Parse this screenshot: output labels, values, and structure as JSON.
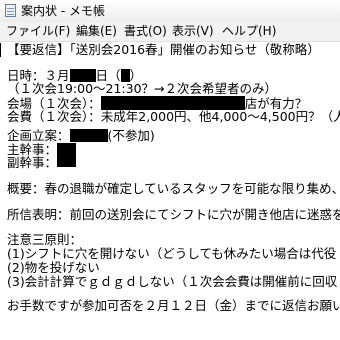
{
  "window": {
    "title": "案内状 - メモ帳"
  },
  "menu": {
    "items": [
      "ファイル(F)",
      "編集(E)",
      "書式(O)",
      "表示(V)",
      "ヘルプ(H)"
    ]
  },
  "document": {
    "line_0": "【要返信】「送別会2016春」開催のお知らせ（敬称略）",
    "line_1a": "日時：３月",
    "line_1b": "日（",
    "line_1c": "）",
    "line_2": "（１次会19:00～21:30？→２次会希望者のみ）",
    "line_3a": "会場（１次会）：",
    "line_3b": "店が有力？",
    "line_4": "会費（１次会）：未成年2,000円、他4,000～4,500円？（人",
    "line_5a": "企画立案：",
    "line_5b": "(不参加)",
    "line_6": "主幹事：",
    "line_7": "副幹事：",
    "line_8": "概要：春の退職が確定しているスタッフを可能な限り集め、",
    "line_9": "所信表明：前回の送別会にてシフトに穴が開き他店に迷惑を",
    "line_10": "注意三原則：",
    "line_11": "(1)シフトに穴を開けない（どうしても休みたい場合は代役",
    "line_12": "(2)物を投げない",
    "line_13": "(3)会計計算でｇｄｇｄしない（１次会会費は開催前に回収",
    "line_14": "お手数ですが参加可否を２月１２日（金）までに返信お願い"
  }
}
